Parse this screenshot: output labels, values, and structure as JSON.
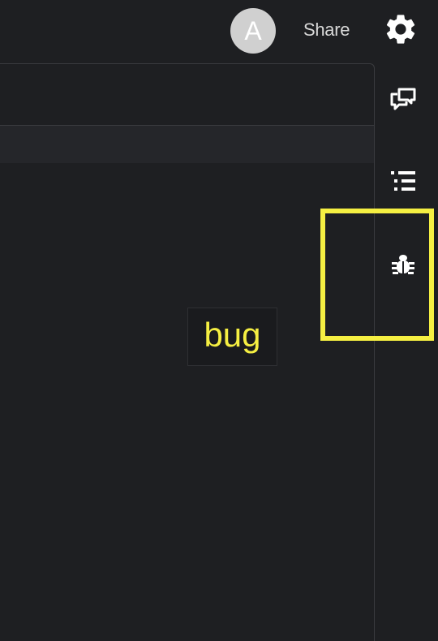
{
  "header": {
    "avatar_initial": "A",
    "share_label": "Share",
    "settings_icon": "gear-icon"
  },
  "rail": {
    "icons": [
      "chat-bubbles-icon",
      "list-icon",
      "bug-icon"
    ]
  },
  "tooltip": {
    "text": "bug"
  },
  "colors": {
    "background": "#1e1f22",
    "highlight": "#f5ef42",
    "avatar": "#d0d0d0"
  }
}
